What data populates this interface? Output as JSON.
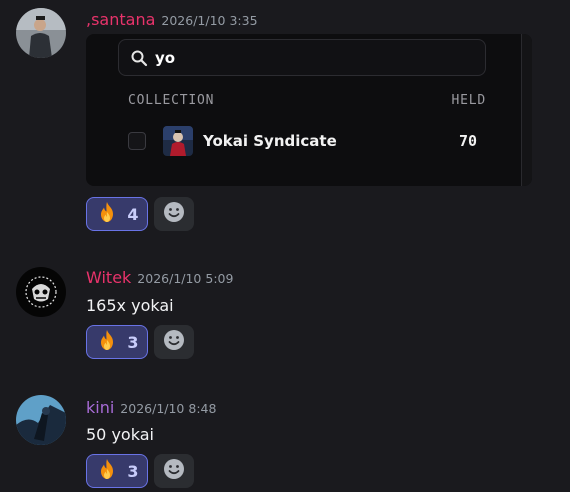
{
  "messages": [
    {
      "username": ",santana",
      "username_color": "#e8336b",
      "timestamp": "2026/1/10 3:35",
      "reaction": {
        "emoji": "fire",
        "count": "4"
      },
      "embed": {
        "search": {
          "value": "yo"
        },
        "columns": {
          "collection": "COLLECTION",
          "held": "HELD"
        },
        "rows": [
          {
            "name": "Yokai Syndicate",
            "held": "70",
            "checked": false
          }
        ]
      }
    },
    {
      "username": "Witek",
      "username_color": "#e8336b",
      "timestamp": "2026/1/10 5:09",
      "text": "165x yokai",
      "reaction": {
        "emoji": "fire",
        "count": "3"
      }
    },
    {
      "username": "kini",
      "username_color": "#a76bd6",
      "timestamp": "2026/1/10 8:48",
      "text": "50 yokai",
      "reaction": {
        "emoji": "fire",
        "count": "3"
      }
    }
  ],
  "icons": {
    "search": "search-icon",
    "reaction": "fire-emoji-icon",
    "add_reaction": "smiley-icon"
  },
  "colors": {
    "background": "#1a1a1e",
    "reaction_bg": "#373a6b",
    "reaction_border": "#6973e6",
    "accent_text": "#c9cdfb"
  }
}
